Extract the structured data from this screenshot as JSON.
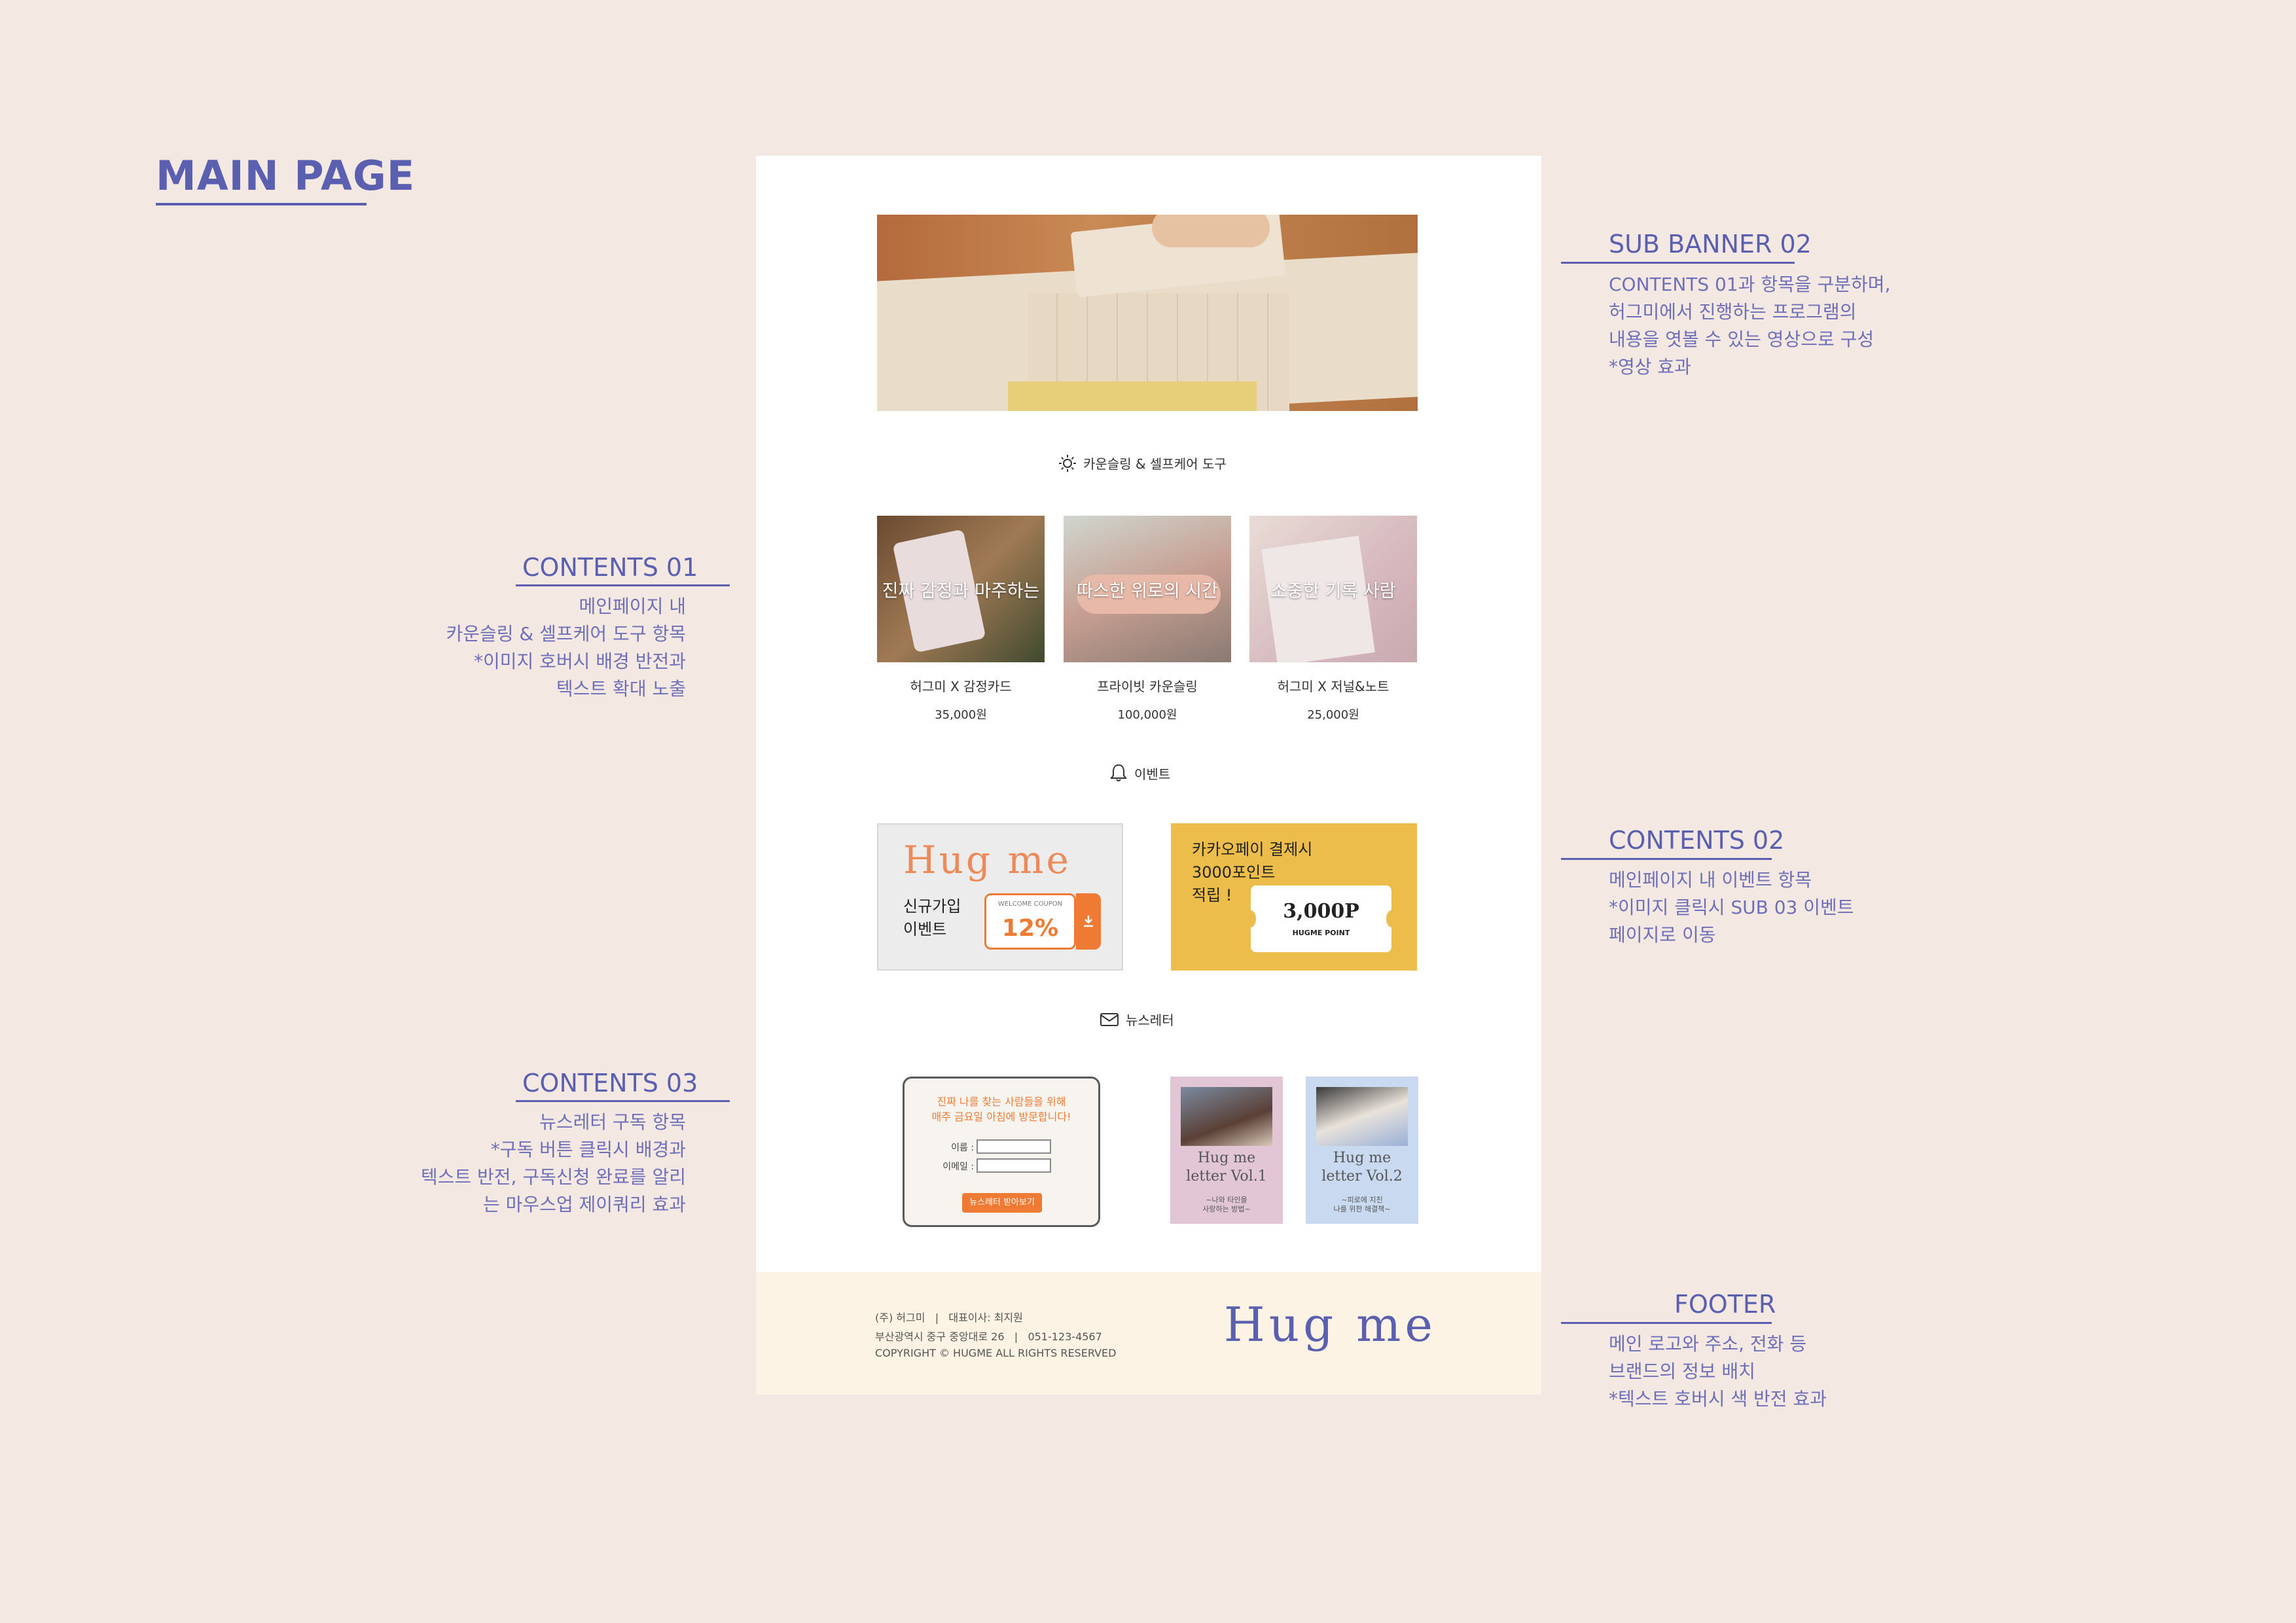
{
  "main_title": "MAIN PAGE",
  "annotations": {
    "sub_banner": {
      "title": "SUB BANNER 02",
      "text": "CONTENTS 01과 항목을 구분하며,\n허그미에서 진행하는 프로그램의\n내용을 엿볼 수 있는 영상으로 구성\n*영상 효과"
    },
    "contents01": {
      "title": "CONTENTS 01",
      "text": "메인페이지 내\n카운슬링 & 셀프케어 도구 항목\n*이미지 호버시 배경 반전과\n텍스트 확대 노출"
    },
    "contents02": {
      "title": "CONTENTS 02",
      "text": "메인페이지 내 이벤트 항목\n*이미지 클릭시 SUB 03 이벤트\n페이지로 이동"
    },
    "contents03": {
      "title": "CONTENTS 03",
      "text": "뉴스레터 구독 항목\n*구독 버튼 클릭시 배경과\n텍스트 반전, 구독신청 완료를 알리\n는 마우스업 제이쿼리 효과"
    },
    "footer": {
      "title": "FOOTER",
      "text": "메인 로고와 주소, 전화 등\n브랜드의 정보 배치\n*텍스트 호버시 색 반전 효과"
    }
  },
  "page": {
    "tools_heading": "카운슬링 & 셀프케어 도구",
    "products": [
      {
        "overlay": "진짜 감정과 마주하는",
        "name": "허그미 X 감정카드",
        "price": "35,000원"
      },
      {
        "overlay": "따스한 위로의 시간",
        "name": "프라이빗 카운슬링",
        "price": "100,000원"
      },
      {
        "overlay": "소중한 기록 사람",
        "name": "허그미 X 저널&노트",
        "price": "25,000원"
      }
    ],
    "event_heading": "이벤트",
    "event1": {
      "logo": "Hug me",
      "line1": "신규가입",
      "line2": "이벤트",
      "coupon_label": "WELCOME COUPON",
      "coupon_value": "12%"
    },
    "event2": {
      "line1": "카카오페이 결제시",
      "line2": "3000포인트",
      "line3": "적립 !",
      "ticket_value": "3,000P",
      "ticket_label": "HUGME POINT"
    },
    "newsletter_heading": "뉴스레터",
    "newsletter": {
      "line1": "진짜 나를 찾는 사람들을 위해",
      "line2": "매주 금요일 아침에 방문합니다!",
      "name_label": "이름 :",
      "email_label": "이메일 :",
      "button": "뉴스레터 받아보기"
    },
    "letters": [
      {
        "title1": "Hug me",
        "title2": "letter Vol.1",
        "sub1": "~나와 타인을",
        "sub2": "사랑하는 방법~"
      },
      {
        "title1": "Hug me",
        "title2": "letter Vol.2",
        "sub1": "~피로에 지친",
        "sub2": "나를 위한 해결책~"
      }
    ]
  },
  "footer": {
    "line1": "(주) 허그미   |   대표이사: 최지원",
    "line2": "부산광역시 중구 중앙대로 26   |   051-123-4567",
    "line3": "COPYRIGHT © HUGME ALL RIGHTS RESERVED",
    "logo": "Hug me"
  },
  "colors": {
    "accent": "#5b5fb0",
    "orange": "#ee7a33",
    "yellow": "#ecbd4a",
    "footer_bg": "#fdf3e4",
    "bg": "#f3e8e2"
  }
}
